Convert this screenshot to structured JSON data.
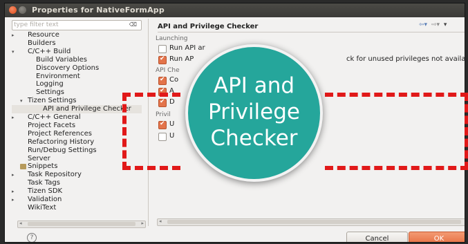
{
  "window": {
    "title": "Properties for NativeFormApp"
  },
  "filter": {
    "placeholder": "type filter text",
    "clear_icon": "⌫"
  },
  "tree": [
    {
      "label": "Resource",
      "arrow": "▸"
    },
    {
      "label": "Builders"
    },
    {
      "label": "C/C++ Build",
      "arrow": "▾"
    },
    {
      "label": "Build Variables"
    },
    {
      "label": "Discovery Options"
    },
    {
      "label": "Environment"
    },
    {
      "label": "Logging"
    },
    {
      "label": "Settings"
    },
    {
      "label": "Tizen Settings",
      "arrow": "▾"
    },
    {
      "label": "API and Privilege Checker",
      "selected": true
    },
    {
      "label": "C/C++ General",
      "arrow": "▸"
    },
    {
      "label": "Project Facets"
    },
    {
      "label": "Project References"
    },
    {
      "label": "Refactoring History"
    },
    {
      "label": "Run/Debug Settings"
    },
    {
      "label": "Server"
    },
    {
      "label": "Snippets",
      "icon": "snippets-icon"
    },
    {
      "label": "Task Repository",
      "arrow": "▸"
    },
    {
      "label": "Task Tags"
    },
    {
      "label": "Tizen SDK",
      "arrow": "▸"
    },
    {
      "label": "Validation",
      "arrow": "▸"
    },
    {
      "label": "WikiText"
    }
  ],
  "page": {
    "title": "API and Privilege Checker",
    "nav_back": "⇦▾",
    "nav_forward": "⇨▾",
    "menu": "▾"
  },
  "groups": {
    "launching": "Launching",
    "api_check": "API Che",
    "privilege": "Privil"
  },
  "options": {
    "run_api_1": "Run API ar",
    "run_api_2": "Run AP",
    "run_api_2_tail": "ck for unused privileges not available",
    "api_opt_1": "Co",
    "api_opt_2": "A",
    "api_opt_3": "D",
    "priv_opt_1": "U",
    "priv_opt_2": "U"
  },
  "checks": {
    "run_api_1": false,
    "run_api_2": true,
    "api_opt_1": true,
    "api_opt_2": true,
    "api_opt_3": true,
    "priv_opt_1": true,
    "priv_opt_2": false
  },
  "callout": {
    "line1": "API and",
    "line2": "Privilege",
    "line3": "Checker",
    "color": "#25a69b",
    "dash_color": "#e11919"
  },
  "footer": {
    "help": "?",
    "cancel": "Cancel",
    "ok": "OK"
  },
  "colors": {
    "accent": "#e66b3d",
    "titlebar": "#3d3c38"
  }
}
